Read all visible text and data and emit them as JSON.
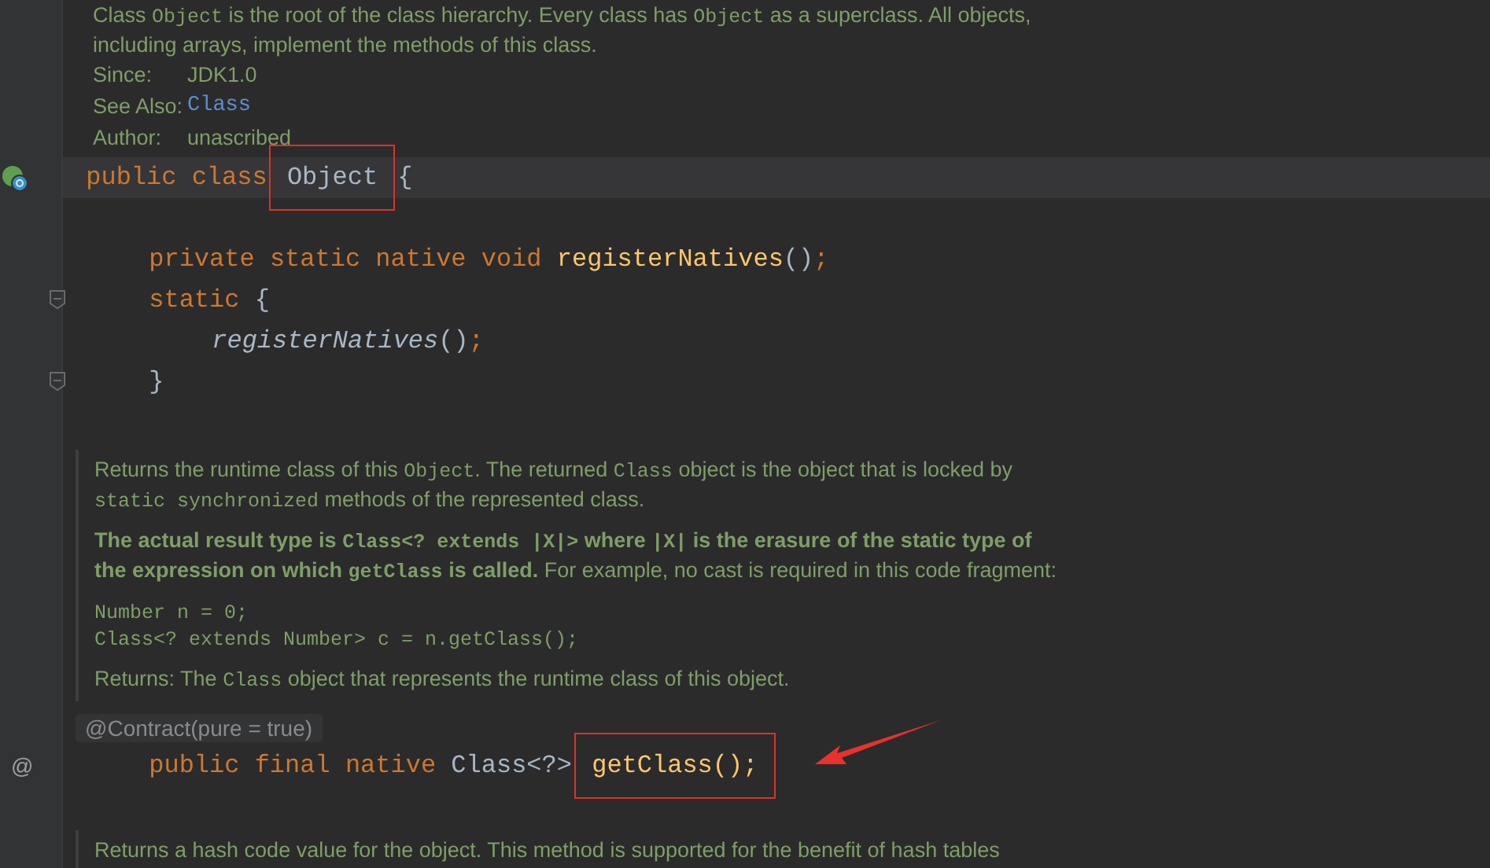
{
  "top_doc": {
    "paragraphs": [
      [
        {
          "kind": "text",
          "text": "Class "
        },
        {
          "kind": "code",
          "text": "Object"
        },
        {
          "kind": "text",
          "text": " is the root of the class hierarchy. Every class has "
        },
        {
          "kind": "code",
          "text": "Object"
        },
        {
          "kind": "text",
          "text": " as a superclass. All objects, including arrays, implement the methods of this class."
        }
      ]
    ],
    "fields": [
      {
        "label": "Since:",
        "value": "JDK1.0",
        "kind": "text"
      },
      {
        "label": "See Also:",
        "value": "Class",
        "kind": "link"
      },
      {
        "label": "Author:",
        "value": "unascribed",
        "kind": "text"
      }
    ]
  },
  "body": [
    {
      "kind": "line",
      "marker": {
        "kind": "class"
      },
      "current": true,
      "tokens": [
        {
          "kind": "keyword",
          "text": "public"
        },
        {
          "kind": "keyword",
          "text": "class"
        },
        {
          "kind": "plain",
          "text": "Object",
          "boxed": true
        },
        {
          "kind": "plain",
          "text": "{"
        }
      ],
      "children": [
        {
          "kind": "blank"
        },
        {
          "kind": "line",
          "current": false,
          "tokens": [
            {
              "kind": "keyword",
              "text": "private"
            },
            {
              "kind": "keyword",
              "text": "static"
            },
            {
              "kind": "keyword",
              "text": "native"
            },
            {
              "kind": "keyword",
              "text": "void"
            },
            {
              "kind": "method",
              "text": "registerNatives"
            },
            {
              "kind": "plain",
              "text": "()",
              "glue": true
            },
            {
              "kind": "punct",
              "text": ";",
              "glue": true
            }
          ]
        },
        {
          "kind": "line",
          "marker": {
            "kind": "fold"
          },
          "current": false,
          "tokens": [
            {
              "kind": "keyword",
              "text": "static"
            },
            {
              "kind": "plain",
              "text": "{"
            }
          ],
          "children": [
            {
              "kind": "line",
              "current": false,
              "tokens": [
                {
                  "kind": "call",
                  "text": "registerNatives"
                },
                {
                  "kind": "plain",
                  "text": "()",
                  "glue": true
                },
                {
                  "kind": "punct",
                  "text": ";",
                  "glue": true
                }
              ]
            }
          ]
        },
        {
          "kind": "line",
          "marker": {
            "kind": "fold"
          },
          "current": false,
          "tokens": [
            {
              "kind": "plain",
              "text": "}"
            }
          ]
        },
        {
          "kind": "blank"
        },
        {
          "kind": "doc",
          "paragraphs": [
            [
              {
                "kind": "text",
                "text": "Returns the runtime class of this "
              },
              {
                "kind": "code",
                "text": "Object"
              },
              {
                "kind": "text",
                "text": ". The returned "
              },
              {
                "kind": "code",
                "text": "Class"
              },
              {
                "kind": "text",
                "text": " object is the object that is locked by "
              },
              {
                "kind": "code",
                "text": "static synchronized"
              },
              {
                "kind": "text",
                "text": " methods of the represented class."
              }
            ],
            [
              {
                "kind": "bold",
                "text": "The actual result type is "
              },
              {
                "kind": "boldcode",
                "text": "Class<? extends |X|>"
              },
              {
                "kind": "bold",
                "text": " where "
              },
              {
                "kind": "boldcode",
                "text": "|X|"
              },
              {
                "kind": "bold",
                "text": " is the erasure of the static type of the expression on which "
              },
              {
                "kind": "boldcode",
                "text": "getClass"
              },
              {
                "kind": "bold",
                "text": " is called."
              },
              {
                "kind": "text",
                "text": " For example, no cast is required in this code fragment:"
              }
            ]
          ],
          "snippet": [
            "Number n = 0;",
            "Class<? extends Number> c = n.getClass();"
          ],
          "returns": {
            "label": "Returns:",
            "segments": [
              {
                "kind": "text",
                "text": " The "
              },
              {
                "kind": "code",
                "text": "Class"
              },
              {
                "kind": "text",
                "text": " object that represents the runtime class of this object."
              }
            ]
          }
        },
        {
          "kind": "annotation",
          "text": "@Contract(pure = true)"
        },
        {
          "kind": "line",
          "marker": {
            "kind": "text",
            "text": "@"
          },
          "current": false,
          "tokens": [
            {
              "kind": "keyword",
              "text": "public"
            },
            {
              "kind": "keyword",
              "text": "final"
            },
            {
              "kind": "keyword",
              "text": "native"
            },
            {
              "kind": "plain",
              "text": "Class<?>"
            },
            {
              "kind": "method",
              "text": "getClass();",
              "boxed": true
            }
          ]
        },
        {
          "kind": "doc",
          "paragraphs": [
            [
              {
                "kind": "text",
                "text": "Returns a hash code value for the object. This method is supported for the benefit of hash tables"
              }
            ]
          ]
        }
      ]
    }
  ]
}
